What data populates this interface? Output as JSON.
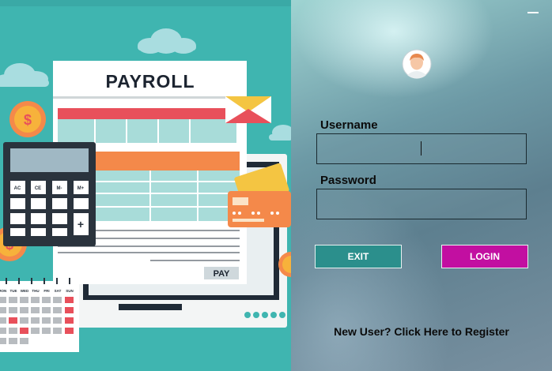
{
  "illustration": {
    "document_title": "PAYROLL",
    "pay_label": "PAY",
    "calculator_keys": [
      "AC",
      "CE",
      "M-",
      "M+"
    ],
    "calendar_days": [
      "MON",
      "TUE",
      "WED",
      "THU",
      "FRI",
      "SAT",
      "SUN"
    ],
    "colors": {
      "background": "#3fb5b0",
      "accent_red": "#e8505b",
      "accent_orange": "#f4894a",
      "accent_teal": "#a8dcd9"
    }
  },
  "login": {
    "username_label": "Username",
    "password_label": "Password",
    "username_value": "",
    "password_value": "",
    "exit_label": "EXIT",
    "login_label": "LOGIN",
    "register_text": "New User? Click Here to Register",
    "colors": {
      "exit_button": "#2b8f8c",
      "login_button": "#c20fa1"
    },
    "icons": {
      "avatar": "user-avatar-icon",
      "minimize": "minimize-icon"
    }
  }
}
